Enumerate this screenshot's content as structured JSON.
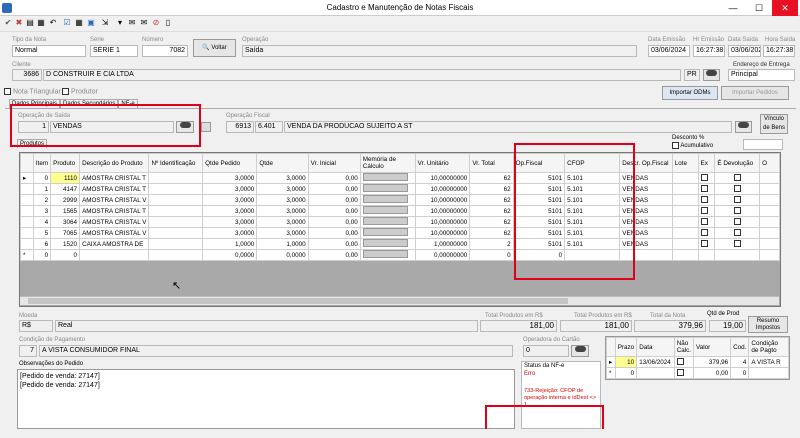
{
  "window": {
    "title": "Cadastro e Manutenção de Notas Fiscais"
  },
  "header": {
    "tipo_label": "Tipo da Nota",
    "tipo": "Normal",
    "serie_label": "Série",
    "serie": "SÉRIE 1",
    "numero_label": "Número",
    "numero": "7082",
    "voltar": "Voltar",
    "operacao_label": "Operação",
    "operacao": "Saída",
    "data_emissao_label": "Data Emissão",
    "data_emissao": "03/06/2024",
    "hr_emissao_label": "Hr Emissão",
    "hr_emissao": "16:27:38",
    "data_saida_label": "Data Saída",
    "data_saida": "03/06/2024",
    "hora_saida_label": "Hora Saída",
    "hora_saida": "16:27:38"
  },
  "cliente": {
    "label": "Cliente",
    "codigo": "3686",
    "nome": "D CONSTRUIR E CIA LTDA",
    "uf": "PR",
    "endereco_label": "Endereço de Entrega",
    "endereco": "Principal"
  },
  "options": {
    "nota_triangular": "Nota Triangular",
    "produtor": "Produtor",
    "importar_odms": "Importar ODMs",
    "importar_pedidos": "Importar Pedidos"
  },
  "tabs": [
    "Dados Principais",
    "Dados Secundários",
    "NF-e"
  ],
  "operacao_saida": {
    "label": "Operação de Saída",
    "codigo": "1",
    "nome": "VENDAS"
  },
  "operacao_fiscal": {
    "label": "Operação Fiscal",
    "codigo": "6913",
    "cfop": "6.401",
    "nome": "VENDA DA PRODUCAO SUJEITO A ST",
    "vinculo": "Vínculo de Bens"
  },
  "produtos_tab": "Produtos",
  "desconto": {
    "label": "Desconto %",
    "acumulativo": "Acumulativo"
  },
  "columns": [
    "Item",
    "Produto",
    "Descrição do Produto",
    "Nº Identificação",
    "Qtde Pedido",
    "Qtde",
    "Vr. Inicial",
    "Memória de Cálculo",
    "Vr. Unitário",
    "Vr. Total",
    "Op.Fiscal",
    "CFOP",
    "Descr. Op.Fiscal",
    "Lote",
    "Ex",
    "É Devolução",
    "O"
  ],
  "rows": [
    {
      "item": "0",
      "produto": "1110",
      "desc": "AMOSTRA CRISTAL T",
      "ident": "",
      "qtde_pedido": "3,0000",
      "qtde": "3,0000",
      "vr_inicial": "0,00",
      "vr_unit": "10,00000000",
      "vr_total": "62",
      "opf": "5101",
      "cfop": "5.101",
      "descr": "VENDAS"
    },
    {
      "item": "1",
      "produto": "4147",
      "desc": "AMOSTRA CRISTAL T",
      "ident": "",
      "qtde_pedido": "3,0000",
      "qtde": "3,0000",
      "vr_inicial": "0,00",
      "vr_unit": "10,00000000",
      "vr_total": "62",
      "opf": "5101",
      "cfop": "5.101",
      "descr": "VENDAS"
    },
    {
      "item": "2",
      "produto": "2999",
      "desc": "AMOSTRA CRISTAL V",
      "ident": "",
      "qtde_pedido": "3,0000",
      "qtde": "3,0000",
      "vr_inicial": "0,00",
      "vr_unit": "10,00000000",
      "vr_total": "62",
      "opf": "5101",
      "cfop": "5.101",
      "descr": "VENDAS"
    },
    {
      "item": "3",
      "produto": "1565",
      "desc": "AMOSTRA CRISTAL T",
      "ident": "",
      "qtde_pedido": "3,0000",
      "qtde": "3,0000",
      "vr_inicial": "0,00",
      "vr_unit": "10,00000000",
      "vr_total": "62",
      "opf": "5101",
      "cfop": "5.101",
      "descr": "VENDAS"
    },
    {
      "item": "4",
      "produto": "3064",
      "desc": "AMOSTRA CRISTAL V",
      "ident": "",
      "qtde_pedido": "3,0000",
      "qtde": "3,0000",
      "vr_inicial": "0,00",
      "vr_unit": "10,00000000",
      "vr_total": "62",
      "opf": "5101",
      "cfop": "5.101",
      "descr": "VENDAS"
    },
    {
      "item": "5",
      "produto": "7065",
      "desc": "AMOSTRA CRISTAL V",
      "ident": "",
      "qtde_pedido": "3,0000",
      "qtde": "3,0000",
      "vr_inicial": "0,00",
      "vr_unit": "10,00000000",
      "vr_total": "62",
      "opf": "5101",
      "cfop": "5.101",
      "descr": "VENDAS"
    },
    {
      "item": "6",
      "produto": "1520",
      "desc": "CAIXA AMOSTRA DE",
      "ident": "",
      "qtde_pedido": "1,0000",
      "qtde": "1,0000",
      "vr_inicial": "0,00",
      "vr_unit": "1,00000000",
      "vr_total": "2",
      "opf": "5101",
      "cfop": "5.101",
      "descr": "VENDAS"
    },
    {
      "item": "0",
      "produto": "0",
      "desc": "",
      "ident": "",
      "qtde_pedido": "0,0000",
      "qtde": "0,0000",
      "vr_inicial": "0,00",
      "vr_unit": "0,00000000",
      "vr_total": "0",
      "opf": "0",
      "cfop": "",
      "descr": ""
    }
  ],
  "totals": {
    "moeda_label": "Moeda",
    "moeda_codigo": "R$",
    "moeda_nome": "Real",
    "prod_rs_label": "Total Produtos em R$",
    "prod_rs": "181,00",
    "prod_moeda_label": "Total Produtos em R$",
    "prod_moeda": "181,00",
    "nota_label": "Total da Nota",
    "nota": "379,96",
    "qtd_prod_label": "Qtd de Prod",
    "qtd_prod": "19,00",
    "resumo": "Resumo Impostos"
  },
  "pagamento": {
    "label": "Condição de Pagamento",
    "codigo": "7",
    "nome": "A VISTA CONSUMIDOR FINAL",
    "cartao_label": "Operadora do Cartão",
    "cartao": "0"
  },
  "parcelas": {
    "columns": [
      "Prazo",
      "Data",
      "Não Calc.",
      "Valor",
      "Cod.",
      "Condição de Pagto"
    ],
    "rows": [
      {
        "prazo": "10",
        "data": "13/06/2024",
        "valor": "379,96",
        "cod": "4",
        "cond": "A VISTA R"
      },
      {
        "prazo": "0",
        "data": "",
        "valor": "0,00",
        "cod": "0",
        "cond": ""
      }
    ]
  },
  "obs": {
    "label": "Observações do Pedido",
    "lines": [
      "[Pedido de venda: 27147]",
      "[Pedido de venda: 27147]"
    ]
  },
  "nfe": {
    "label": "Status da NF-e",
    "status": "Erro",
    "msg": "733-Rejeição: CFOP de operação interna e idDest <> 1"
  }
}
